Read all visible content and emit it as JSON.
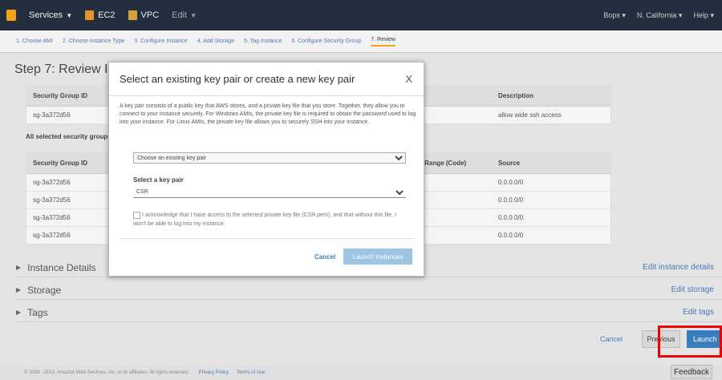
{
  "topbar": {
    "services": "Services",
    "ec2": "EC2",
    "vpc": "VPC",
    "edit": "Edit",
    "user": "Bops",
    "region": "N. California",
    "help": "Help"
  },
  "wizard": {
    "steps": [
      "1. Choose AMI",
      "2. Choose Instance Type",
      "3. Configure Instance",
      "4. Add Storage",
      "5. Tag Instance",
      "6. Configure Security Group",
      "7. Review"
    ]
  },
  "page": {
    "title": "Step 7: Review Instance Launch",
    "table1": {
      "headers": [
        "Security Group ID",
        "",
        "Description"
      ],
      "rows": [
        [
          "sg-3a372d56",
          "",
          "allow wide ssh access"
        ]
      ]
    },
    "all_selected": "All selected security groups inbound rules",
    "table2": {
      "headers": [
        "Security Group ID",
        "",
        "Port Range (Code)",
        "Source"
      ],
      "rows": [
        [
          "sg-3a372d56",
          "",
          "",
          "0.0.0.0/0"
        ],
        [
          "sg-3a372d56",
          "",
          "",
          "0.0.0.0/0"
        ],
        [
          "sg-3a372d56",
          "",
          "",
          "0.0.0.0/0"
        ],
        [
          "sg-3a372d56",
          "",
          "",
          "0.0.0.0/0"
        ]
      ]
    },
    "sections": [
      {
        "label": "Instance Details",
        "edit": "Edit instance details"
      },
      {
        "label": "Storage",
        "edit": "Edit storage"
      },
      {
        "label": "Tags",
        "edit": "Edit tags"
      }
    ],
    "actions": {
      "cancel": "Cancel",
      "previous": "Previous",
      "launch": "Launch"
    }
  },
  "footer": {
    "copyright": "© 2008 - 2013, Amazon Web Services, Inc. or its affiliates. All rights reserved.",
    "privacy": "Privacy Policy",
    "terms": "Terms of Use",
    "feedback": "Feedback"
  },
  "modal": {
    "title": "Select an existing key pair or create a new key pair",
    "close": "X",
    "description": "A key pair consists of a public key that AWS stores, and a private key file that you store. Together, they allow you to connect to your instance securely. For Windows AMIs, the private key file is required to obtain the password used to log into your instance. For Linux AMIs, the private key file allows you to securely SSH into your instance.",
    "choose_option": "Choose an existing key pair",
    "select_label": "Select a key pair",
    "key_value": "CSR",
    "ack": "I acknowledge that I have access to the selected private key file (CSR.pem), and that without this file, I won't be able to log into my instance.",
    "cancel": "Cancel",
    "launch": "Launch Instances"
  }
}
